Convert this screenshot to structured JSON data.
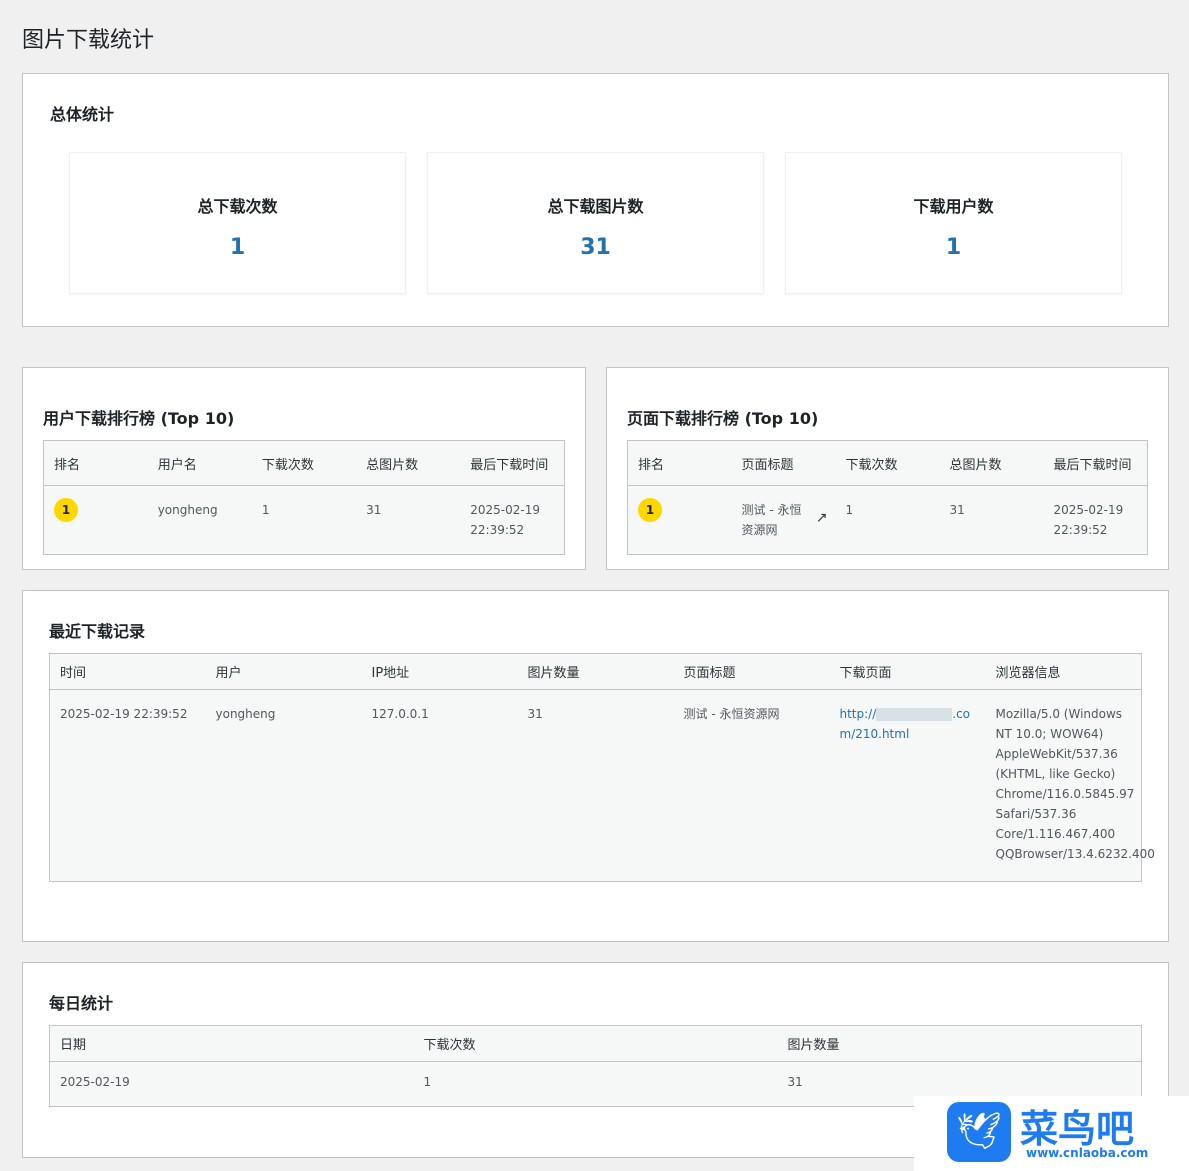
{
  "page_title": "图片下载统计",
  "overall": {
    "title": "总体统计",
    "stats": [
      {
        "label": "总下载次数",
        "value": "1"
      },
      {
        "label": "总下载图片数",
        "value": "31"
      },
      {
        "label": "下载用户数",
        "value": "1"
      }
    ]
  },
  "user_rank": {
    "title": "用户下载排行榜 (Top 10)",
    "headers": [
      "排名",
      "用户名",
      "下载次数",
      "总图片数",
      "最后下载时间"
    ],
    "rows": [
      {
        "rank": "1",
        "name": "yongheng",
        "count": "1",
        "images": "31",
        "last": "2025-02-19 22:39:52"
      }
    ]
  },
  "page_rank": {
    "title": "页面下载排行榜 (Top 10)",
    "headers": [
      "排名",
      "页面标题",
      "下载次数",
      "总图片数",
      "最后下载时间"
    ],
    "rows": [
      {
        "rank": "1",
        "title": "测试 - 永恒资源网",
        "count": "1",
        "images": "31",
        "last": "2025-02-19 22:39:52"
      }
    ]
  },
  "recent": {
    "title": "最近下载记录",
    "headers": [
      "时间",
      "用户",
      "IP地址",
      "图片数量",
      "页面标题",
      "下载页面",
      "浏览器信息"
    ],
    "rows": [
      {
        "time": "2025-02-19 22:39:52",
        "user": "yongheng",
        "ip": "127.0.0.1",
        "count": "31",
        "title": "测试 - 永恒资源网",
        "url_prefix": "http://",
        "url_suffix": ".com/210.html",
        "ua": "Mozilla/5.0 (Windows NT 10.0; WOW64) AppleWebKit/537.36 (KHTML, like Gecko) Chrome/116.0.5845.97 Safari/537.36 Core/1.116.467.400 QQBrowser/13.4.6232.400"
      }
    ]
  },
  "daily": {
    "title": "每日统计",
    "headers": [
      "日期",
      "下载次数",
      "图片数量"
    ],
    "rows": [
      {
        "date": "2025-02-19",
        "count": "1",
        "images": "31"
      }
    ]
  },
  "watermark": {
    "name": "菜鸟吧",
    "url": "www.cnlaoba.com",
    "color": "#1e7bf0"
  }
}
